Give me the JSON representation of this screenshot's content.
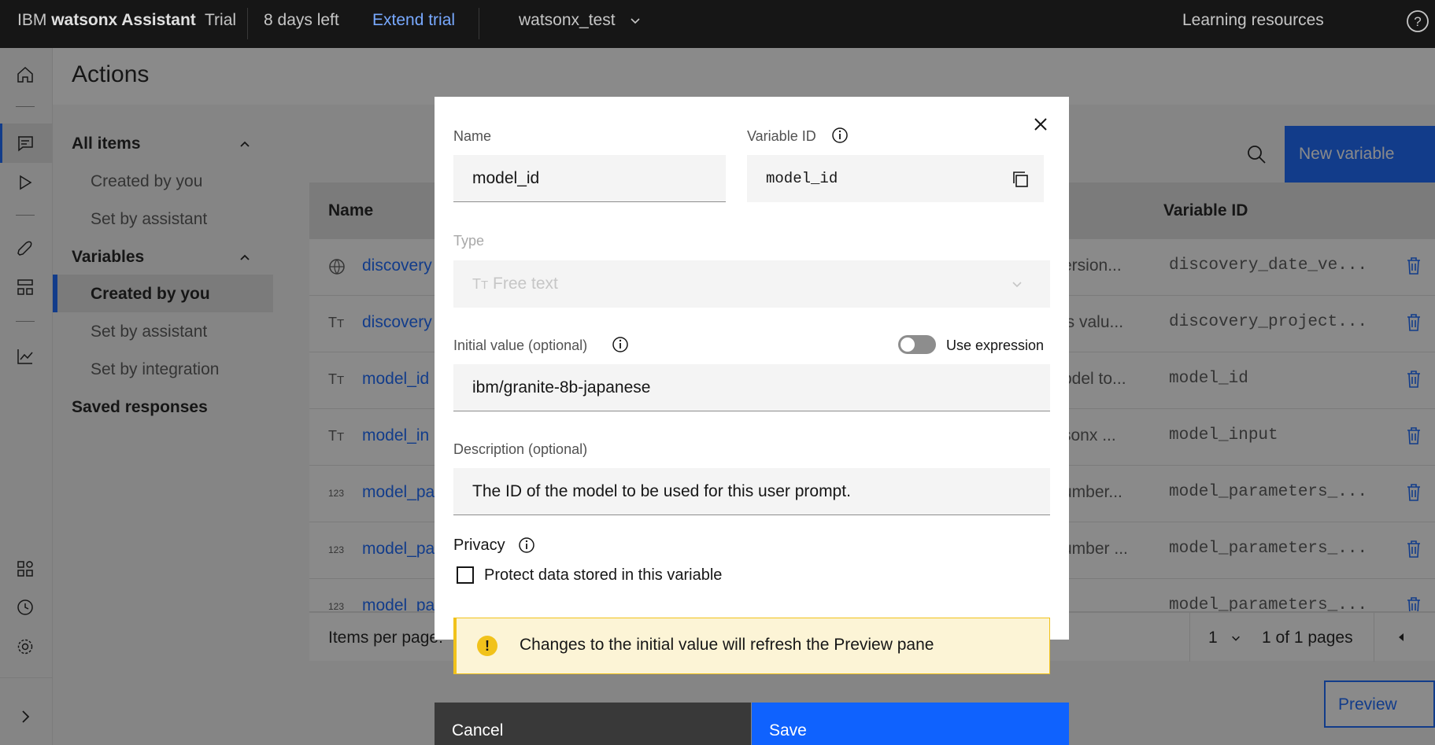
{
  "topbar": {
    "brand_ibm": "IBM",
    "brand_product": "watsonx Assistant",
    "plan": "Trial",
    "days_left": "8 days left",
    "extend": "Extend trial",
    "workspace": "watsonx_test",
    "learning": "Learning resources"
  },
  "page": {
    "title": "Actions"
  },
  "leftnav": {
    "all_items": "All items",
    "all_created": "Created by you",
    "all_set_assistant": "Set by assistant",
    "variables": "Variables",
    "var_created": "Created by you",
    "var_set_assistant": "Set by assistant",
    "var_set_integration": "Set by integration",
    "saved_responses": "Saved responses"
  },
  "table": {
    "new_variable": "New variable",
    "col_name": "Name",
    "col_varid": "Variable ID",
    "rows": [
      {
        "icon": "globe-icon",
        "name": "discovery",
        "desc": "ersion...",
        "id": "discovery_date_ve..."
      },
      {
        "icon": "text-icon",
        "name": "discovery",
        "desc": "is valu...",
        "id": "discovery_project..."
      },
      {
        "icon": "text-icon",
        "name": "model_id",
        "desc": "odel to...",
        "id": "model_id"
      },
      {
        "icon": "text-icon",
        "name": "model_in",
        "desc": "sonx ...",
        "id": "model_input"
      },
      {
        "icon": "number-icon",
        "name": "model_pa",
        "desc": "umber...",
        "id": "model_parameters_..."
      },
      {
        "icon": "number-icon",
        "name": "model_pa",
        "desc": "umber ...",
        "id": "model_parameters_..."
      },
      {
        "icon": "number-icon",
        "name": "model_pa",
        "desc": "",
        "id": "model_parameters_..."
      }
    ],
    "items_per_page": "Items per page:",
    "page_num": "1",
    "page_of": "1 of 1 pages",
    "preview": "Preview"
  },
  "modal": {
    "name_label": "Name",
    "name_value": "model_id",
    "varid_label": "Variable ID",
    "varid_value": "model_id",
    "type_label": "Type",
    "type_value": "Free text",
    "initial_label": "Initial value (optional)",
    "use_expression": "Use expression",
    "initial_value": "ibm/granite-8b-japanese",
    "desc_label": "Description (optional)",
    "desc_value": "The ID of the model to be used for this user prompt.",
    "privacy_label": "Privacy",
    "protect_label": "Protect data stored in this variable",
    "notification": "Changes to the initial value will refresh the Preview pane",
    "cancel": "Cancel",
    "save": "Save"
  },
  "colors": {
    "primary": "#0f62fe",
    "warning": "#f1c21b",
    "topbar": "#161616"
  }
}
